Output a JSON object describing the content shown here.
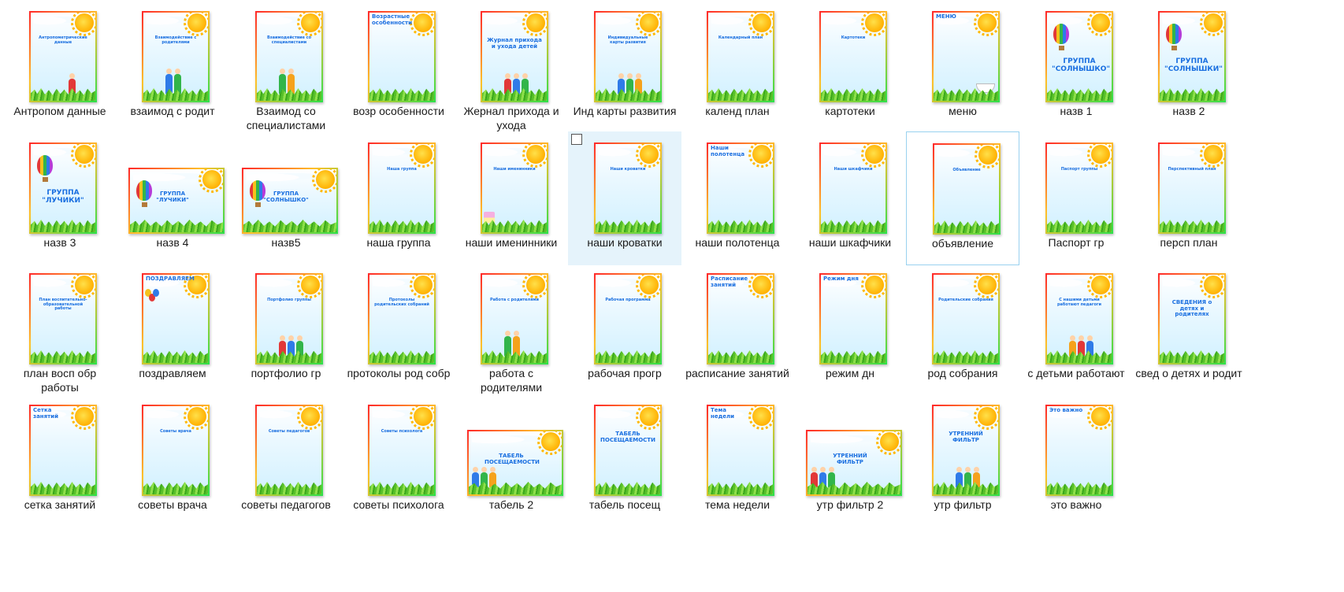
{
  "files": [
    {
      "name": "Антропом данные",
      "thumb": {
        "title": "Антропометрические данные",
        "style": "small",
        "art": "girl"
      }
    },
    {
      "name": "взаимод с родит",
      "thumb": {
        "title": "Взаимодействие с родителями",
        "style": "small",
        "art": "family"
      }
    },
    {
      "name": "Взаимод со специалистами",
      "thumb": {
        "title": "Взаимодействие со специалистами",
        "style": "small",
        "art": "family"
      }
    },
    {
      "name": "возр особенности",
      "thumb": {
        "title": "Возрастные особенности",
        "style": "top",
        "art": "none"
      }
    },
    {
      "name": "Жернал прихода и ухода",
      "thumb": {
        "title": "Журнал прихода и ухода детей",
        "style": "mid",
        "art": "kids"
      }
    },
    {
      "name": "Инд карты развития",
      "thumb": {
        "title": "Индивидуальные карты развития",
        "style": "small",
        "art": "kids"
      }
    },
    {
      "name": "календ план",
      "thumb": {
        "title": "Календарный план",
        "style": "small",
        "art": "none"
      }
    },
    {
      "name": "картотеки",
      "thumb": {
        "title": "Картотеки",
        "style": "small",
        "art": "none"
      }
    },
    {
      "name": "меню",
      "thumb": {
        "title": "МЕНЮ",
        "style": "top",
        "art": "bowl"
      }
    },
    {
      "name": "назв 1",
      "thumb": {
        "title": "ГРУППА \"СОЛНЫШКО\"",
        "style": "big",
        "art": "balloon"
      }
    },
    {
      "name": "назв 2",
      "thumb": {
        "title": "ГРУППА \"СОЛНЫШКИ\"",
        "style": "big",
        "art": "balloon"
      }
    },
    {
      "name": "назв 3",
      "thumb": {
        "title": "ГРУППА \"ЛУЧИКИ\"",
        "style": "big",
        "art": "balloon"
      }
    },
    {
      "name": "назв 4",
      "thumb": {
        "title": "ГРУППА \"ЛУЧИКИ\"",
        "style": "mid",
        "art": "balloon"
      }
    },
    {
      "name": "назв5",
      "thumb": {
        "title": "ГРУППА \"СОЛНЫШКО\"",
        "style": "mid",
        "art": "balloon"
      }
    },
    {
      "name": "наша группа",
      "thumb": {
        "title": "Наша группа",
        "style": "small",
        "art": "none"
      }
    },
    {
      "name": "наши именинники",
      "thumb": {
        "title": "Наши именинники",
        "style": "small",
        "art": "cake"
      }
    },
    {
      "name": "наши кроватки",
      "thumb": {
        "title": "Наши кроватки",
        "style": "small",
        "art": "none"
      }
    },
    {
      "name": "наши полотенца",
      "thumb": {
        "title": "Наши полотенца",
        "style": "top",
        "art": "none"
      }
    },
    {
      "name": "наши шкафчики",
      "thumb": {
        "title": "Наши шкафчики",
        "style": "small",
        "art": "none"
      }
    },
    {
      "name": "объявление",
      "thumb": {
        "title": "Объявление",
        "style": "small",
        "art": "none"
      }
    },
    {
      "name": "Паспорт гр",
      "thumb": {
        "title": "Паспорт группы",
        "style": "small",
        "art": "none"
      }
    },
    {
      "name": "персп план",
      "thumb": {
        "title": "Перспективный план",
        "style": "small",
        "art": "none"
      }
    },
    {
      "name": "план восп обр работы",
      "thumb": {
        "title": "План воспитательно-образовательной работы",
        "style": "small",
        "art": "none"
      }
    },
    {
      "name": "поздравляем",
      "thumb": {
        "title": "ПОЗДРАВЛЯЕМ",
        "style": "top",
        "art": "balloons"
      }
    },
    {
      "name": "портфолио гр",
      "thumb": {
        "title": "Портфолио группы",
        "style": "small",
        "art": "kids"
      }
    },
    {
      "name": "протоколы род собр",
      "thumb": {
        "title": "Протоколы родительских собраний",
        "style": "small",
        "art": "none"
      }
    },
    {
      "name": "работа с родителями",
      "thumb": {
        "title": "Работа с родителями",
        "style": "small",
        "art": "family"
      }
    },
    {
      "name": "рабочая прогр",
      "thumb": {
        "title": "Рабочая программа",
        "style": "small",
        "art": "none"
      }
    },
    {
      "name": "расписание занятий",
      "thumb": {
        "title": "Расписание занятий",
        "style": "top",
        "art": "none"
      }
    },
    {
      "name": "режим дн",
      "thumb": {
        "title": "Режим дня",
        "style": "top",
        "art": "none"
      }
    },
    {
      "name": "род собрания",
      "thumb": {
        "title": "Родительские собрания",
        "style": "small",
        "art": "none"
      }
    },
    {
      "name": "с детьми работают",
      "thumb": {
        "title": "С нашими детьми работают педагоги",
        "style": "small",
        "art": "kids"
      }
    },
    {
      "name": "свед о детях и родит",
      "thumb": {
        "title": "СВЕДЕНИЯ о детях и родителях",
        "style": "mid",
        "art": "none"
      }
    },
    {
      "name": "сетка занятий",
      "thumb": {
        "title": "Сетка занятий",
        "style": "top",
        "art": "none"
      }
    },
    {
      "name": "советы врача",
      "thumb": {
        "title": "Советы врача",
        "style": "small",
        "art": "none"
      }
    },
    {
      "name": "советы педагогов",
      "thumb": {
        "title": "Советы педагогов",
        "style": "small",
        "art": "none"
      }
    },
    {
      "name": "советы психолога",
      "thumb": {
        "title": "Советы психолога",
        "style": "small",
        "art": "none"
      }
    },
    {
      "name": "табель 2",
      "thumb": {
        "title": "ТАБЕЛЬ ПОСЕЩАЕМОСТИ",
        "style": "mid",
        "art": "kids"
      }
    },
    {
      "name": "табель посещ",
      "thumb": {
        "title": "ТАБЕЛЬ ПОСЕЩАЕМОСТИ",
        "style": "mid",
        "art": "none"
      }
    },
    {
      "name": "тема недели",
      "thumb": {
        "title": "Тема недели",
        "style": "top",
        "art": "none"
      }
    },
    {
      "name": "утр фильтр 2",
      "thumb": {
        "title": "УТРЕННИЙ ФИЛЬТР",
        "style": "mid",
        "art": "kids"
      }
    },
    {
      "name": "утр фильтр",
      "thumb": {
        "title": "УТРЕННИЙ ФИЛЬТР",
        "style": "mid",
        "art": "kids"
      }
    },
    {
      "name": "это важно",
      "thumb": {
        "title": "Это важно",
        "style": "top",
        "art": "none"
      }
    }
  ],
  "landscape_items": [
    "назв 4",
    "назв5",
    "табель 2",
    "утр фильтр 2"
  ],
  "hovered_item": "наши кроватки",
  "focused_item": "объявление",
  "colors": {
    "title_blue": "#1a6fe0",
    "hover": "#e5f3fb",
    "focus_border": "#99d1ef"
  }
}
